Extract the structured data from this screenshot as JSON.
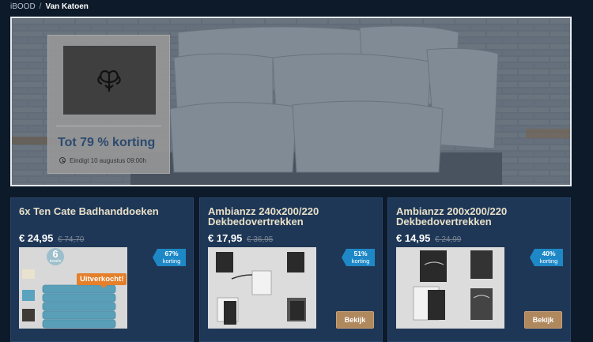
{
  "breadcrumb": {
    "home": "iBOOD",
    "separator": "/",
    "current": "Van Katoen"
  },
  "hero": {
    "logo_icon": "cotton-flower-icon",
    "deal_text": "Tot 79 % korting",
    "ends_icon": "clock-icon",
    "ends_text": "Eindigt 10 augustus 09:00h"
  },
  "products": [
    {
      "title": "6x Ten Cate Badhanddoeken",
      "price": "€ 24,95",
      "old_price": "€ 74,70",
      "discount": "67%",
      "discount_label": "korting",
      "status": "Uitverkocht!",
      "thumb_number": "6",
      "thumb_caption": "towels"
    },
    {
      "title": "Ambianzz 240x200/220 Dekbedovertrekken",
      "price": "€ 17,95",
      "old_price": "€ 36,95",
      "discount": "51%",
      "discount_label": "korting",
      "button": "Bekijk"
    },
    {
      "title": "Ambianzz 200x200/220 Dekbedovertrekken",
      "price": "€ 14,95",
      "old_price": "€ 24,99",
      "discount": "40%",
      "discount_label": "korting",
      "button": "Bekijk"
    }
  ]
}
